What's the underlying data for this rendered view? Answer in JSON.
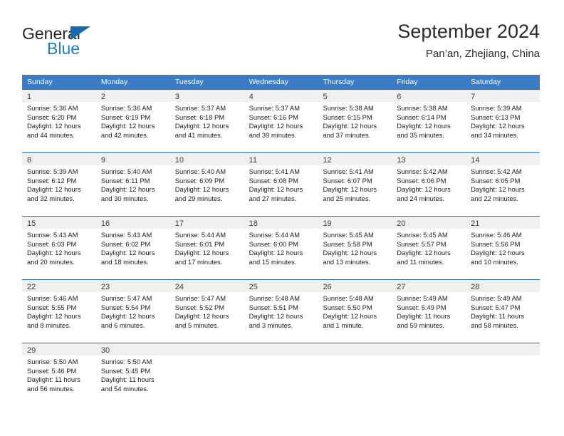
{
  "brand": {
    "name_primary": "General",
    "name_secondary": "Blue",
    "triangle_color": "#1769b0",
    "blue_color": "#1f7dc4"
  },
  "header": {
    "title": "September 2024",
    "subtitle": "Pan’an, Zhejiang, China"
  },
  "theme": {
    "header_blue": "#3b7cc4",
    "rule_blue": "#2a68ad",
    "day_band_gray": "#f0f0f0"
  },
  "weekdays": [
    "Sunday",
    "Monday",
    "Tuesday",
    "Wednesday",
    "Thursday",
    "Friday",
    "Saturday"
  ],
  "weeks": [
    [
      {
        "day": "1",
        "sunrise": "Sunrise: 5:36 AM",
        "sunset": "Sunset: 6:20 PM",
        "daylight1": "Daylight: 12 hours",
        "daylight2": "and 44 minutes."
      },
      {
        "day": "2",
        "sunrise": "Sunrise: 5:36 AM",
        "sunset": "Sunset: 6:19 PM",
        "daylight1": "Daylight: 12 hours",
        "daylight2": "and 42 minutes."
      },
      {
        "day": "3",
        "sunrise": "Sunrise: 5:37 AM",
        "sunset": "Sunset: 6:18 PM",
        "daylight1": "Daylight: 12 hours",
        "daylight2": "and 41 minutes."
      },
      {
        "day": "4",
        "sunrise": "Sunrise: 5:37 AM",
        "sunset": "Sunset: 6:16 PM",
        "daylight1": "Daylight: 12 hours",
        "daylight2": "and 39 minutes."
      },
      {
        "day": "5",
        "sunrise": "Sunrise: 5:38 AM",
        "sunset": "Sunset: 6:15 PM",
        "daylight1": "Daylight: 12 hours",
        "daylight2": "and 37 minutes."
      },
      {
        "day": "6",
        "sunrise": "Sunrise: 5:38 AM",
        "sunset": "Sunset: 6:14 PM",
        "daylight1": "Daylight: 12 hours",
        "daylight2": "and 35 minutes."
      },
      {
        "day": "7",
        "sunrise": "Sunrise: 5:39 AM",
        "sunset": "Sunset: 6:13 PM",
        "daylight1": "Daylight: 12 hours",
        "daylight2": "and 34 minutes."
      }
    ],
    [
      {
        "day": "8",
        "sunrise": "Sunrise: 5:39 AM",
        "sunset": "Sunset: 6:12 PM",
        "daylight1": "Daylight: 12 hours",
        "daylight2": "and 32 minutes."
      },
      {
        "day": "9",
        "sunrise": "Sunrise: 5:40 AM",
        "sunset": "Sunset: 6:11 PM",
        "daylight1": "Daylight: 12 hours",
        "daylight2": "and 30 minutes."
      },
      {
        "day": "10",
        "sunrise": "Sunrise: 5:40 AM",
        "sunset": "Sunset: 6:09 PM",
        "daylight1": "Daylight: 12 hours",
        "daylight2": "and 29 minutes."
      },
      {
        "day": "11",
        "sunrise": "Sunrise: 5:41 AM",
        "sunset": "Sunset: 6:08 PM",
        "daylight1": "Daylight: 12 hours",
        "daylight2": "and 27 minutes."
      },
      {
        "day": "12",
        "sunrise": "Sunrise: 5:41 AM",
        "sunset": "Sunset: 6:07 PM",
        "daylight1": "Daylight: 12 hours",
        "daylight2": "and 25 minutes."
      },
      {
        "day": "13",
        "sunrise": "Sunrise: 5:42 AM",
        "sunset": "Sunset: 6:06 PM",
        "daylight1": "Daylight: 12 hours",
        "daylight2": "and 24 minutes."
      },
      {
        "day": "14",
        "sunrise": "Sunrise: 5:42 AM",
        "sunset": "Sunset: 6:05 PM",
        "daylight1": "Daylight: 12 hours",
        "daylight2": "and 22 minutes."
      }
    ],
    [
      {
        "day": "15",
        "sunrise": "Sunrise: 5:43 AM",
        "sunset": "Sunset: 6:03 PM",
        "daylight1": "Daylight: 12 hours",
        "daylight2": "and 20 minutes."
      },
      {
        "day": "16",
        "sunrise": "Sunrise: 5:43 AM",
        "sunset": "Sunset: 6:02 PM",
        "daylight1": "Daylight: 12 hours",
        "daylight2": "and 18 minutes."
      },
      {
        "day": "17",
        "sunrise": "Sunrise: 5:44 AM",
        "sunset": "Sunset: 6:01 PM",
        "daylight1": "Daylight: 12 hours",
        "daylight2": "and 17 minutes."
      },
      {
        "day": "18",
        "sunrise": "Sunrise: 5:44 AM",
        "sunset": "Sunset: 6:00 PM",
        "daylight1": "Daylight: 12 hours",
        "daylight2": "and 15 minutes."
      },
      {
        "day": "19",
        "sunrise": "Sunrise: 5:45 AM",
        "sunset": "Sunset: 5:58 PM",
        "daylight1": "Daylight: 12 hours",
        "daylight2": "and 13 minutes."
      },
      {
        "day": "20",
        "sunrise": "Sunrise: 5:45 AM",
        "sunset": "Sunset: 5:57 PM",
        "daylight1": "Daylight: 12 hours",
        "daylight2": "and 11 minutes."
      },
      {
        "day": "21",
        "sunrise": "Sunrise: 5:46 AM",
        "sunset": "Sunset: 5:56 PM",
        "daylight1": "Daylight: 12 hours",
        "daylight2": "and 10 minutes."
      }
    ],
    [
      {
        "day": "22",
        "sunrise": "Sunrise: 5:46 AM",
        "sunset": "Sunset: 5:55 PM",
        "daylight1": "Daylight: 12 hours",
        "daylight2": "and 8 minutes."
      },
      {
        "day": "23",
        "sunrise": "Sunrise: 5:47 AM",
        "sunset": "Sunset: 5:54 PM",
        "daylight1": "Daylight: 12 hours",
        "daylight2": "and 6 minutes."
      },
      {
        "day": "24",
        "sunrise": "Sunrise: 5:47 AM",
        "sunset": "Sunset: 5:52 PM",
        "daylight1": "Daylight: 12 hours",
        "daylight2": "and 5 minutes."
      },
      {
        "day": "25",
        "sunrise": "Sunrise: 5:48 AM",
        "sunset": "Sunset: 5:51 PM",
        "daylight1": "Daylight: 12 hours",
        "daylight2": "and 3 minutes."
      },
      {
        "day": "26",
        "sunrise": "Sunrise: 5:48 AM",
        "sunset": "Sunset: 5:50 PM",
        "daylight1": "Daylight: 12 hours",
        "daylight2": "and 1 minute."
      },
      {
        "day": "27",
        "sunrise": "Sunrise: 5:49 AM",
        "sunset": "Sunset: 5:49 PM",
        "daylight1": "Daylight: 11 hours",
        "daylight2": "and 59 minutes."
      },
      {
        "day": "28",
        "sunrise": "Sunrise: 5:49 AM",
        "sunset": "Sunset: 5:47 PM",
        "daylight1": "Daylight: 11 hours",
        "daylight2": "and 58 minutes."
      }
    ],
    [
      {
        "day": "29",
        "sunrise": "Sunrise: 5:50 AM",
        "sunset": "Sunset: 5:46 PM",
        "daylight1": "Daylight: 11 hours",
        "daylight2": "and 56 minutes."
      },
      {
        "day": "30",
        "sunrise": "Sunrise: 5:50 AM",
        "sunset": "Sunset: 5:45 PM",
        "daylight1": "Daylight: 11 hours",
        "daylight2": "and 54 minutes."
      },
      {
        "day": "",
        "sunrise": "",
        "sunset": "",
        "daylight1": "",
        "daylight2": ""
      },
      {
        "day": "",
        "sunrise": "",
        "sunset": "",
        "daylight1": "",
        "daylight2": ""
      },
      {
        "day": "",
        "sunrise": "",
        "sunset": "",
        "daylight1": "",
        "daylight2": ""
      },
      {
        "day": "",
        "sunrise": "",
        "sunset": "",
        "daylight1": "",
        "daylight2": ""
      },
      {
        "day": "",
        "sunrise": "",
        "sunset": "",
        "daylight1": "",
        "daylight2": ""
      }
    ]
  ]
}
